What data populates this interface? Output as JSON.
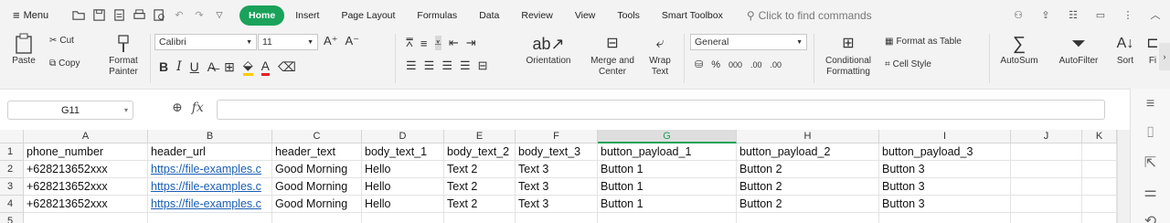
{
  "menu": {
    "label": "Menu"
  },
  "tabs": [
    {
      "label": "Home",
      "active": true
    },
    {
      "label": "Insert"
    },
    {
      "label": "Page Layout"
    },
    {
      "label": "Formulas"
    },
    {
      "label": "Data"
    },
    {
      "label": "Review"
    },
    {
      "label": "View"
    },
    {
      "label": "Tools"
    },
    {
      "label": "Smart Toolbox"
    }
  ],
  "search": {
    "placeholder": "Click to find commands"
  },
  "ribbon": {
    "paste": "Paste",
    "cut": "Cut",
    "copy": "Copy",
    "format_painter_1": "Format",
    "format_painter_2": "Painter",
    "font_name": "Calibri",
    "font_size": "11",
    "orientation": "Orientation",
    "merge_1": "Merge and",
    "merge_2": "Center",
    "wrap_1": "Wrap",
    "wrap_2": "Text",
    "number_format": "General",
    "percent": "%",
    "thousands": "000",
    "dec_inc": ".00",
    "dec_dec": ".00",
    "cond_1": "Conditional",
    "cond_2": "Formatting",
    "format_table": "Format as Table",
    "cell_style": "Cell Style",
    "autosum": "AutoSum",
    "autofilter": "AutoFilter",
    "sort": "Sort",
    "fill": "Fi"
  },
  "formula_bar": {
    "name_box": "G11",
    "fx": "fx",
    "value": ""
  },
  "columns": [
    "A",
    "B",
    "C",
    "D",
    "E",
    "F",
    "G",
    "H",
    "I",
    "J",
    "K"
  ],
  "selected_column": "G",
  "rows": [
    {
      "num": "1",
      "cells": [
        "phone_number",
        "header_url",
        "header_text",
        "body_text_1",
        "body_text_2",
        "body_text_3",
        "button_payload_1",
        "button_payload_2",
        "button_payload_3",
        "",
        ""
      ]
    },
    {
      "num": "2",
      "cells": [
        "+628213652xxx",
        "https://file-examples.c",
        "Good Morning",
        "Hello",
        "Text 2",
        "Text 3",
        "Button 1",
        "Button 2",
        "Button 3",
        "",
        ""
      ]
    },
    {
      "num": "3",
      "cells": [
        "+628213652xxx",
        "https://file-examples.c",
        "Good Morning",
        "Hello",
        "Text 2",
        "Text 3",
        "Button 1",
        "Button 2",
        "Button 3",
        "",
        ""
      ]
    },
    {
      "num": "4",
      "cells": [
        "+628213652xxx",
        "https://file-examples.c",
        "Good Morning",
        "Hello",
        "Text 2",
        "Text 3",
        "Button 1",
        "Button 2",
        "Button 3",
        "",
        ""
      ]
    },
    {
      "num": "5",
      "cells": [
        "",
        "",
        "",
        "",
        "",
        "",
        "",
        "",
        "",
        "",
        ""
      ]
    }
  ]
}
